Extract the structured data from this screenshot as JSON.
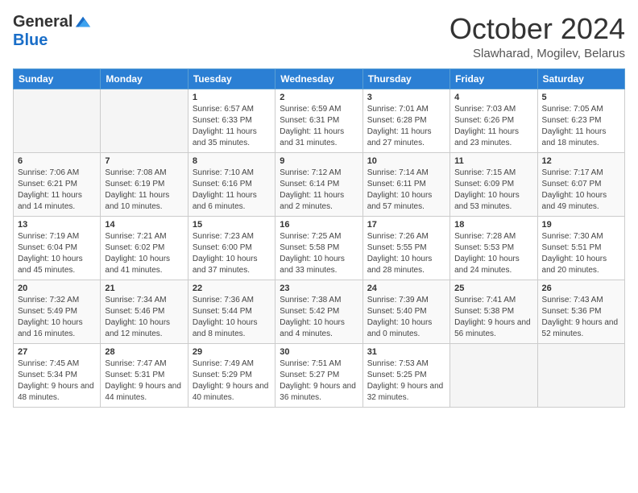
{
  "logo": {
    "general": "General",
    "blue": "Blue"
  },
  "title": "October 2024",
  "location": "Slawharad, Mogilev, Belarus",
  "days_of_week": [
    "Sunday",
    "Monday",
    "Tuesday",
    "Wednesday",
    "Thursday",
    "Friday",
    "Saturday"
  ],
  "weeks": [
    [
      {
        "day": "",
        "info": ""
      },
      {
        "day": "",
        "info": ""
      },
      {
        "day": "1",
        "info": "Sunrise: 6:57 AM\nSunset: 6:33 PM\nDaylight: 11 hours and 35 minutes."
      },
      {
        "day": "2",
        "info": "Sunrise: 6:59 AM\nSunset: 6:31 PM\nDaylight: 11 hours and 31 minutes."
      },
      {
        "day": "3",
        "info": "Sunrise: 7:01 AM\nSunset: 6:28 PM\nDaylight: 11 hours and 27 minutes."
      },
      {
        "day": "4",
        "info": "Sunrise: 7:03 AM\nSunset: 6:26 PM\nDaylight: 11 hours and 23 minutes."
      },
      {
        "day": "5",
        "info": "Sunrise: 7:05 AM\nSunset: 6:23 PM\nDaylight: 11 hours and 18 minutes."
      }
    ],
    [
      {
        "day": "6",
        "info": "Sunrise: 7:06 AM\nSunset: 6:21 PM\nDaylight: 11 hours and 14 minutes."
      },
      {
        "day": "7",
        "info": "Sunrise: 7:08 AM\nSunset: 6:19 PM\nDaylight: 11 hours and 10 minutes."
      },
      {
        "day": "8",
        "info": "Sunrise: 7:10 AM\nSunset: 6:16 PM\nDaylight: 11 hours and 6 minutes."
      },
      {
        "day": "9",
        "info": "Sunrise: 7:12 AM\nSunset: 6:14 PM\nDaylight: 11 hours and 2 minutes."
      },
      {
        "day": "10",
        "info": "Sunrise: 7:14 AM\nSunset: 6:11 PM\nDaylight: 10 hours and 57 minutes."
      },
      {
        "day": "11",
        "info": "Sunrise: 7:15 AM\nSunset: 6:09 PM\nDaylight: 10 hours and 53 minutes."
      },
      {
        "day": "12",
        "info": "Sunrise: 7:17 AM\nSunset: 6:07 PM\nDaylight: 10 hours and 49 minutes."
      }
    ],
    [
      {
        "day": "13",
        "info": "Sunrise: 7:19 AM\nSunset: 6:04 PM\nDaylight: 10 hours and 45 minutes."
      },
      {
        "day": "14",
        "info": "Sunrise: 7:21 AM\nSunset: 6:02 PM\nDaylight: 10 hours and 41 minutes."
      },
      {
        "day": "15",
        "info": "Sunrise: 7:23 AM\nSunset: 6:00 PM\nDaylight: 10 hours and 37 minutes."
      },
      {
        "day": "16",
        "info": "Sunrise: 7:25 AM\nSunset: 5:58 PM\nDaylight: 10 hours and 33 minutes."
      },
      {
        "day": "17",
        "info": "Sunrise: 7:26 AM\nSunset: 5:55 PM\nDaylight: 10 hours and 28 minutes."
      },
      {
        "day": "18",
        "info": "Sunrise: 7:28 AM\nSunset: 5:53 PM\nDaylight: 10 hours and 24 minutes."
      },
      {
        "day": "19",
        "info": "Sunrise: 7:30 AM\nSunset: 5:51 PM\nDaylight: 10 hours and 20 minutes."
      }
    ],
    [
      {
        "day": "20",
        "info": "Sunrise: 7:32 AM\nSunset: 5:49 PM\nDaylight: 10 hours and 16 minutes."
      },
      {
        "day": "21",
        "info": "Sunrise: 7:34 AM\nSunset: 5:46 PM\nDaylight: 10 hours and 12 minutes."
      },
      {
        "day": "22",
        "info": "Sunrise: 7:36 AM\nSunset: 5:44 PM\nDaylight: 10 hours and 8 minutes."
      },
      {
        "day": "23",
        "info": "Sunrise: 7:38 AM\nSunset: 5:42 PM\nDaylight: 10 hours and 4 minutes."
      },
      {
        "day": "24",
        "info": "Sunrise: 7:39 AM\nSunset: 5:40 PM\nDaylight: 10 hours and 0 minutes."
      },
      {
        "day": "25",
        "info": "Sunrise: 7:41 AM\nSunset: 5:38 PM\nDaylight: 9 hours and 56 minutes."
      },
      {
        "day": "26",
        "info": "Sunrise: 7:43 AM\nSunset: 5:36 PM\nDaylight: 9 hours and 52 minutes."
      }
    ],
    [
      {
        "day": "27",
        "info": "Sunrise: 7:45 AM\nSunset: 5:34 PM\nDaylight: 9 hours and 48 minutes."
      },
      {
        "day": "28",
        "info": "Sunrise: 7:47 AM\nSunset: 5:31 PM\nDaylight: 9 hours and 44 minutes."
      },
      {
        "day": "29",
        "info": "Sunrise: 7:49 AM\nSunset: 5:29 PM\nDaylight: 9 hours and 40 minutes."
      },
      {
        "day": "30",
        "info": "Sunrise: 7:51 AM\nSunset: 5:27 PM\nDaylight: 9 hours and 36 minutes."
      },
      {
        "day": "31",
        "info": "Sunrise: 7:53 AM\nSunset: 5:25 PM\nDaylight: 9 hours and 32 minutes."
      },
      {
        "day": "",
        "info": ""
      },
      {
        "day": "",
        "info": ""
      }
    ]
  ]
}
